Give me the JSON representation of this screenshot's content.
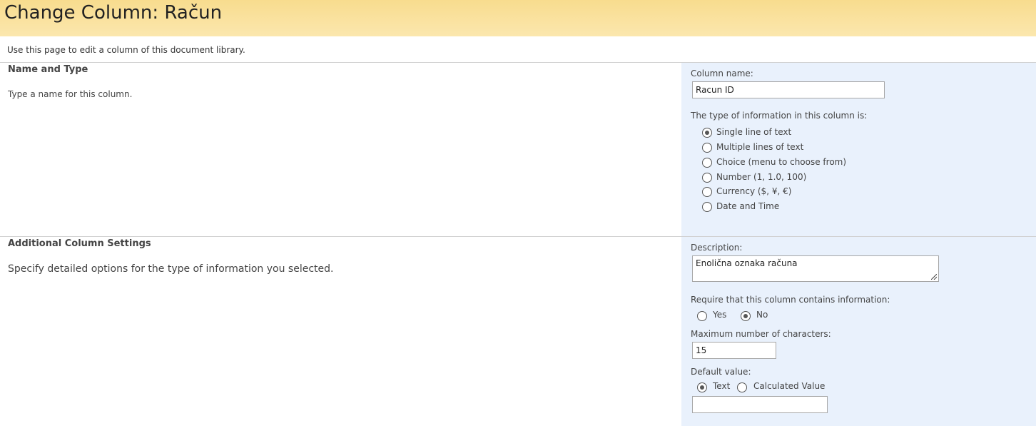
{
  "header": {
    "title": "Change Column: Račun"
  },
  "page_description": "Use this page to edit a column of this document library.",
  "name_and_type": {
    "title": "Name and Type",
    "description": "Type a name for this column.",
    "column_name_label": "Column name:",
    "column_name_value": "Racun ID",
    "type_label": "The type of information in this column is:",
    "types": [
      {
        "label": "Single line of text",
        "checked": true
      },
      {
        "label": "Multiple lines of text",
        "checked": false
      },
      {
        "label": "Choice (menu to choose from)",
        "checked": false
      },
      {
        "label": "Number (1, 1.0, 100)",
        "checked": false
      },
      {
        "label": "Currency ($, ¥, €)",
        "checked": false
      },
      {
        "label": "Date and Time",
        "checked": false
      }
    ]
  },
  "additional_settings": {
    "title": "Additional Column Settings",
    "description": "Specify detailed options for the type of information you selected.",
    "description_label": "Description:",
    "description_value": "Enolična oznaka računa",
    "require_label": "Require that this column contains information:",
    "require_yes": "Yes",
    "require_no": "No",
    "require_selected": "No",
    "max_chars_label": "Maximum number of characters:",
    "max_chars_value": "15",
    "default_value_label": "Default value:",
    "default_text_option": "Text",
    "default_calculated_option": "Calculated Value",
    "default_selected": "Text",
    "default_value": ""
  },
  "colors": {
    "header_gradient_top": "#f8dc8e",
    "header_gradient_bottom": "#fbe7ae",
    "right_panel_bg": "#e9f1fc",
    "divider": "#d0d0d0"
  }
}
